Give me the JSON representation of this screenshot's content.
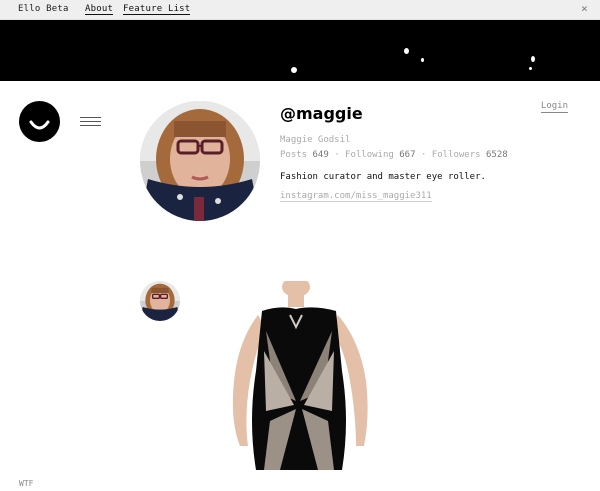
{
  "topbar": {
    "brand": "Ello Beta",
    "links": [
      {
        "label": "About"
      },
      {
        "label": "Feature List"
      }
    ],
    "close_glyph": "×"
  },
  "banner": {
    "background": "#000000"
  },
  "header": {
    "login_label": "Login"
  },
  "profile": {
    "handle": "@maggie",
    "name": "Maggie Godsil",
    "stats": {
      "posts_label": "Posts",
      "posts": "649",
      "following_label": "Following",
      "following": "667",
      "followers_label": "Followers",
      "followers": "6528"
    },
    "bio": "Fashion curator and master eye roller.",
    "link": "instagram.com/miss_maggie311"
  },
  "post": {
    "image_icon": "dress-photo"
  },
  "footer": {
    "wtf_label": "WTF"
  },
  "icons": {
    "logo": "ello-smiley-icon",
    "menu": "hamburger-menu-icon",
    "close": "close-icon"
  }
}
